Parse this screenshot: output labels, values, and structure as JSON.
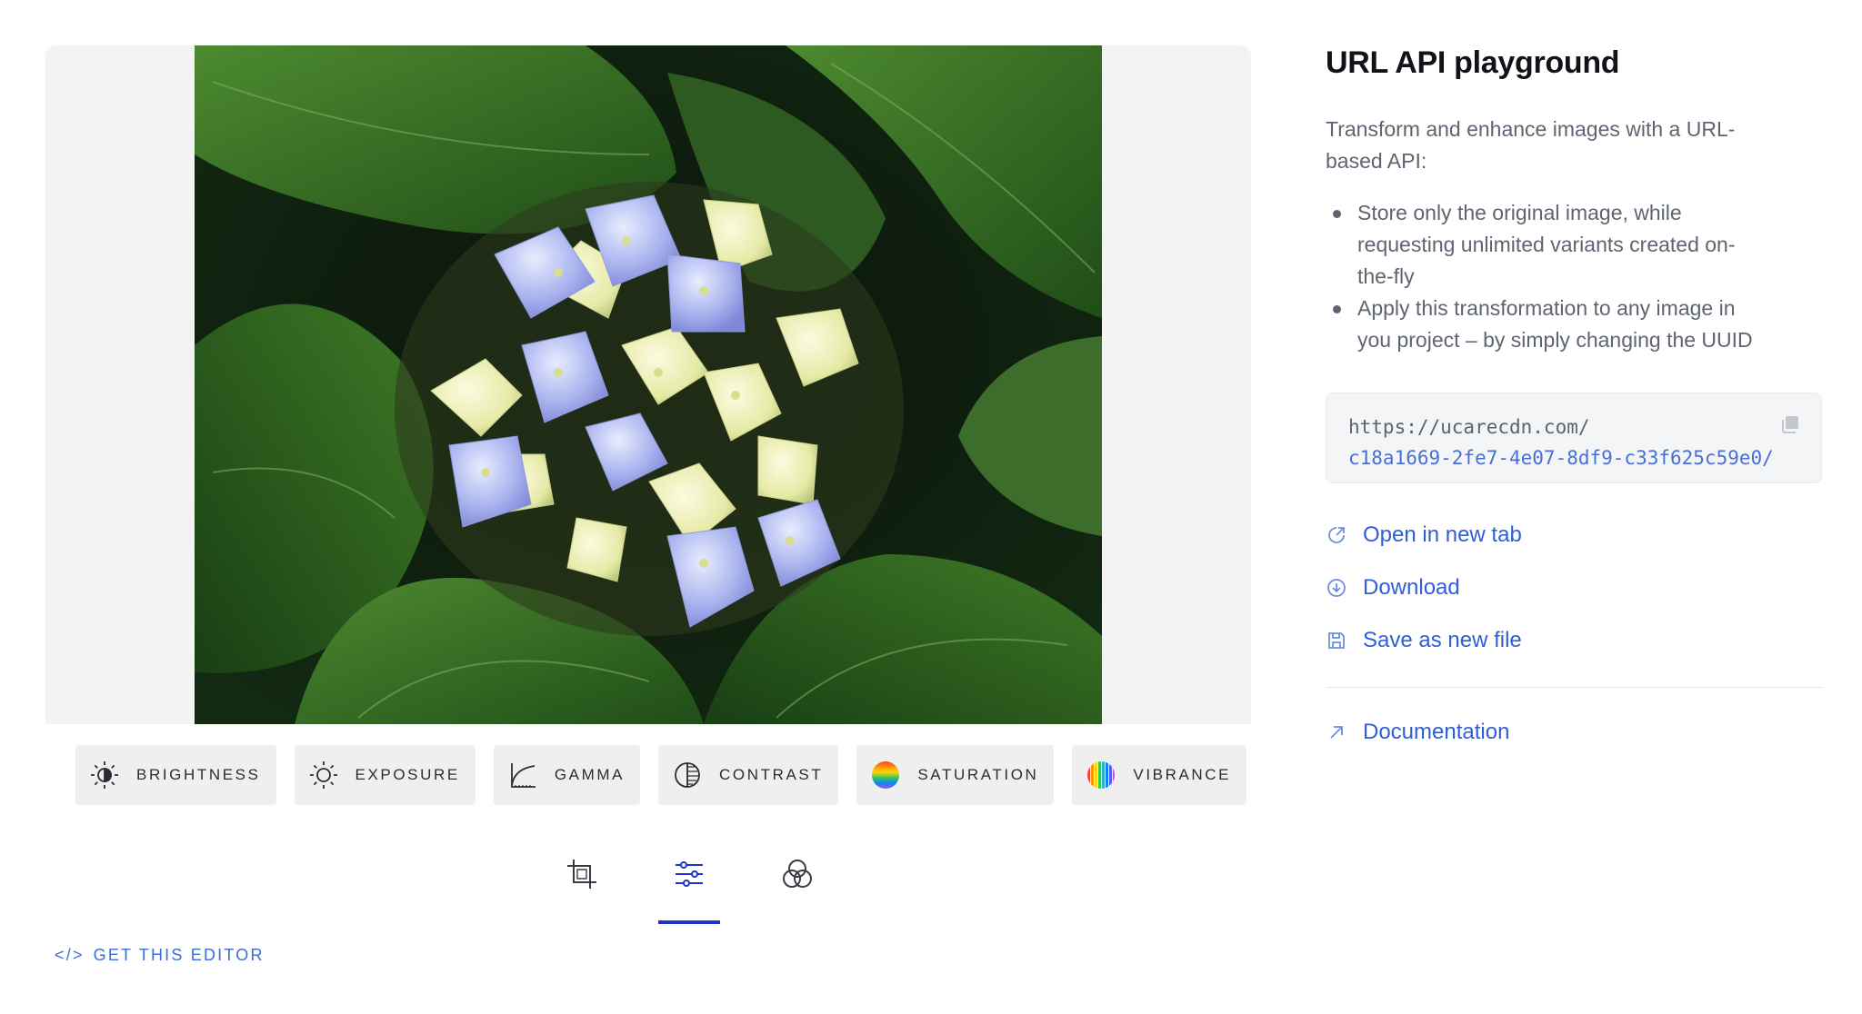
{
  "operations": [
    {
      "label": "BRIGHTNESS",
      "icon": "brightness-icon"
    },
    {
      "label": "EXPOSURE",
      "icon": "exposure-icon"
    },
    {
      "label": "GAMMA",
      "icon": "gamma-icon"
    },
    {
      "label": "CONTRAST",
      "icon": "contrast-icon"
    },
    {
      "label": "SATURATION",
      "icon": "saturation-icon"
    },
    {
      "label": "VIBRANCE",
      "icon": "vibrance-icon"
    },
    {
      "label": "",
      "icon": "thermometer-icon"
    }
  ],
  "tabs": [
    {
      "icon": "crop-icon",
      "active": false
    },
    {
      "icon": "sliders-icon",
      "active": true
    },
    {
      "icon": "filters-icon",
      "active": false
    }
  ],
  "get_editor": {
    "glyph": "</>",
    "label": "GET THIS EDITOR"
  },
  "side": {
    "title": "URL API playground",
    "description": "Transform and enhance images with a URL-based API:",
    "bullets": [
      "Store only the original image, while requesting unlimited variants created on-the-fly",
      "Apply this transformation to any image in you project – by simply changing the UUID"
    ],
    "url_host": "https://ucarecdn.com/",
    "url_uuid": "c18a1669-2fe7-4e07-8df9-c33f625c59e0/",
    "actions": [
      {
        "label": "Open in new tab",
        "icon": "external-link-icon"
      },
      {
        "label": "Download",
        "icon": "download-icon"
      },
      {
        "label": "Save as new file",
        "icon": "save-icon"
      }
    ],
    "doc_link": "Documentation"
  },
  "colors": {
    "accent": "#2233c4",
    "link": "#2f5ed8",
    "canvas_bg": "#f3f3f3"
  }
}
